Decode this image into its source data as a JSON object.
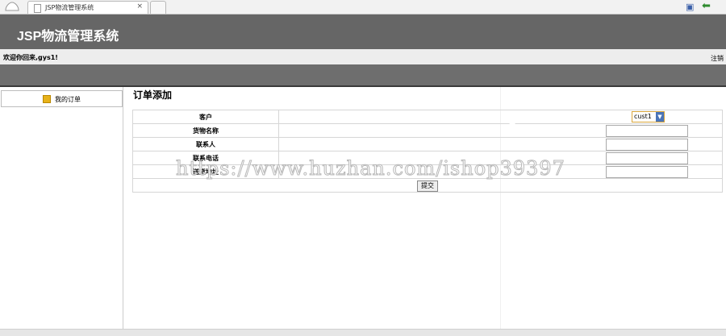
{
  "browser": {
    "tab_title": "JSP物流管理系统",
    "tab_close": "×"
  },
  "header": {
    "app_title": "JSP物流管理系统"
  },
  "infobar": {
    "welcome": "欢迎你回来,gys1!",
    "logout": "注销"
  },
  "sidebar": {
    "items": [
      {
        "label": "我的订单"
      }
    ]
  },
  "main": {
    "title": "订单添加",
    "form": {
      "rows": [
        {
          "label": "客户",
          "value": "cust1"
        },
        {
          "label": "货物名称",
          "value": ""
        },
        {
          "label": "联系人",
          "value": ""
        },
        {
          "label": "联系电话",
          "value": ""
        },
        {
          "label": "送货地址",
          "value": ""
        }
      ],
      "submit_label": "提交"
    }
  },
  "watermark": "https://www.huzhan.com/ishop39397"
}
